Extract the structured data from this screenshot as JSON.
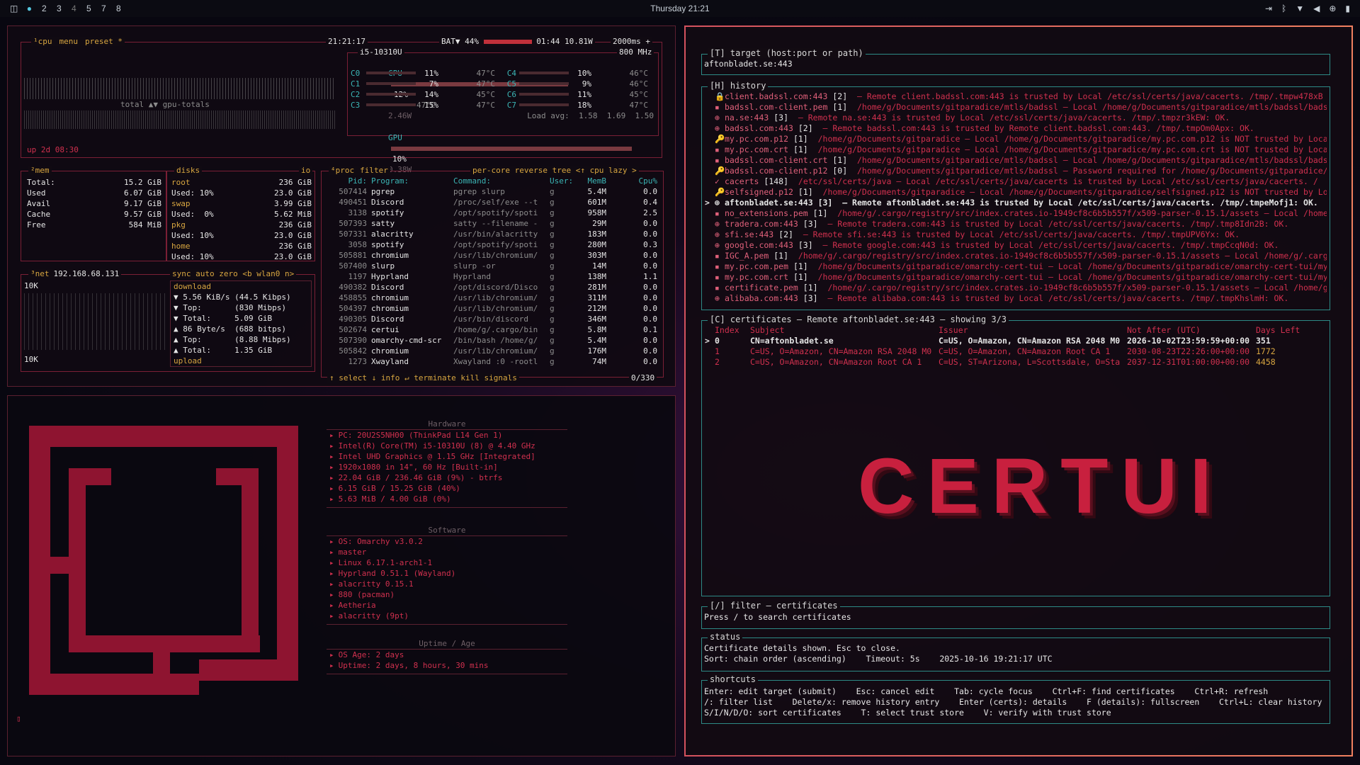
{
  "topbar": {
    "workspaces": [
      "2",
      "3",
      "4",
      "5",
      "7",
      "8"
    ],
    "clock": "Thursday 21:21"
  },
  "btop": {
    "cpu_header": {
      "tabs": [
        "¹cpu",
        "menu",
        "preset *"
      ],
      "time": "21:21:17",
      "battery": "BAT▼ 44%",
      "bat_time": "01:44 10.81W",
      "interval": "2000ms +"
    },
    "cpu_model": "i5-10310U",
    "freq": "800 MHz",
    "cpu_total": {
      "label": "CPU",
      "pct": "12%",
      "temp": "47°C",
      "watt": "2.46W"
    },
    "cores": [
      {
        "l": "C0",
        "p": "11%",
        "t": "47°C",
        "r": "C4",
        "rp": "10%",
        "rt": "46°C"
      },
      {
        "l": "C1",
        "p": "7%",
        "t": "47°C",
        "r": "C5",
        "rp": "9%",
        "rt": "46°C"
      },
      {
        "l": "C2",
        "p": "14%",
        "t": "45°C",
        "r": "C6",
        "rp": "11%",
        "rt": "45°C"
      },
      {
        "l": "C3",
        "p": "15%",
        "t": "47°C",
        "r": "C7",
        "rp": "18%",
        "rt": "47°C"
      }
    ],
    "load": "Load avg:  1.58  1.69  1.50",
    "gpu": {
      "label": "GPU",
      "pct": "10%",
      "watt": "0.38W"
    },
    "gpu_totals": "total ▲▼ gpu-totals",
    "uptime": "up 2d 08:30",
    "mem": {
      "title": "²mem",
      "rows": [
        [
          "Total:",
          "15.2 GiB"
        ],
        [
          "Used",
          "6.07 GiB"
        ],
        [
          "Avail",
          "9.17 GiB"
        ],
        [
          "Cache",
          "9.57 GiB"
        ],
        [
          "Free",
          "584 MiB"
        ]
      ]
    },
    "disks": {
      "title": "disks",
      "io": "io",
      "rows": [
        [
          "root",
          "236 GiB"
        ],
        [
          "Used: 10%",
          "23.0 GiB"
        ],
        [
          "swap",
          "3.99 GiB"
        ],
        [
          "Used:  0%",
          "5.62 MiB"
        ],
        [
          "pkg",
          "236 GiB"
        ],
        [
          "Used: 10%",
          "23.0 GiB"
        ],
        [
          "home",
          "236 GiB"
        ],
        [
          "Used: 10%",
          "23.0 GiB"
        ]
      ]
    },
    "net": {
      "title": "³net",
      "ip": "192.168.68.131",
      "tabs": "sync auto zero <b wlan0 n>",
      "scale_top": "10K",
      "scale_bot": "10K",
      "rows": [
        "download",
        "▼ 5.56 KiB/s (44.5 Kibps)",
        "▼ Top:       (830 Mibps)",
        "▼ Total:     5.09 GiB",
        "▲ 86 Byte/s  (688 bitps)",
        "▲ Top:       (8.88 Mibps)",
        "▲ Total:     1.35 GiB",
        "upload"
      ]
    },
    "proc": {
      "title": "⁴proc",
      "tabs": "filter",
      "opts": "per-core reverse tree <↑ cpu lazy >",
      "header": [
        "Pid:",
        "Program:",
        "Command:",
        "User:",
        "MemB",
        "Cpu%"
      ],
      "rows": [
        [
          "507414",
          "pgrep",
          "pgrep slurp",
          "g",
          "5.4M",
          "0.0"
        ],
        [
          "490451",
          "Discord",
          "/proc/self/exe --t",
          "g",
          "601M",
          "0.4"
        ],
        [
          "3138",
          "spotify",
          "/opt/spotify/spoti",
          "g",
          "958M",
          "2.5"
        ],
        [
          "507393",
          "satty",
          "satty --filename -",
          "g",
          "29M",
          "0.0"
        ],
        [
          "507331",
          "alacritty",
          "/usr/bin/alacritty",
          "g",
          "183M",
          "0.0"
        ],
        [
          "3058",
          "spotify",
          "/opt/spotify/spoti",
          "g",
          "280M",
          "0.3"
        ],
        [
          "505881",
          "chromium",
          "/usr/lib/chromium/",
          "g",
          "303M",
          "0.0"
        ],
        [
          "507400",
          "slurp",
          "slurp -or",
          "g",
          "14M",
          "0.0"
        ],
        [
          "1197",
          "Hyprland",
          "Hyprland",
          "g",
          "138M",
          "1.1"
        ],
        [
          "490382",
          "Discord",
          "/opt/discord/Disco",
          "g",
          "281M",
          "0.0"
        ],
        [
          "458855",
          "chromium",
          "/usr/lib/chromium/",
          "g",
          "311M",
          "0.0"
        ],
        [
          "504397",
          "chromium",
          "/usr/lib/chromium/",
          "g",
          "212M",
          "0.0"
        ],
        [
          "490305",
          "Discord",
          "/usr/bin/discord",
          "g",
          "346M",
          "0.0"
        ],
        [
          "502674",
          "certui",
          "/home/g/.cargo/bin",
          "g",
          "5.8M",
          "0.1"
        ],
        [
          "507390",
          "omarchy-cmd-scr",
          "/bin/bash /home/g/",
          "g",
          "5.4M",
          "0.0"
        ],
        [
          "505842",
          "chromium",
          "/usr/lib/chromium/",
          "g",
          "176M",
          "0.0"
        ],
        [
          "1273",
          "Xwayland",
          "Xwayland :0 -rootl",
          "g",
          "74M",
          "0.0"
        ]
      ],
      "footer": "↑ select ↓  info ↵  terminate  kill  signals",
      "count": "0/330"
    }
  },
  "fastfetch": {
    "hardware_title": "Hardware",
    "hardware": [
      "PC: 20U2S5NH00 (ThinkPad L14 Gen 1)",
      "Intel(R) Core(TM) i5-10310U (8) @ 4.40 GHz",
      "Intel UHD Graphics @ 1.15 GHz [Integrated]",
      "1920x1080 in 14\", 60 Hz [Built-in]",
      "22.04 GiB / 236.46 GiB (9%) - btrfs",
      "6.15 GiB / 15.25 GiB (40%)",
      "5.63 MiB / 4.00 GiB (0%)"
    ],
    "software_title": "Software",
    "software": [
      "OS: Omarchy v3.0.2",
      "master",
      "Linux 6.17.1-arch1-1",
      "Hyprland 0.51.1 (Wayland)",
      "alacritty 0.15.1",
      "880 (pacman)",
      "Aetheria",
      "alacritty (9pt)"
    ],
    "uptime_title": "Uptime / Age",
    "uptime": [
      "OS Age: 2 days",
      "Uptime: 2 days, 8 hours, 30 mins"
    ],
    "prompt": "▯"
  },
  "certui": {
    "target_title": "[T] target (host:port or path)",
    "target_value": "aftonbladet.se:443",
    "history_title": "[H] history",
    "history": [
      {
        "icon": "🔒",
        "name": "client.badssl.com:443",
        "count": "[2]",
        "rest": "– Remote client.badssl.com:443 is trusted by Local /etc/ssl/certs/java/cacerts. /tmp/.tmpw478xB"
      },
      {
        "icon": "▪",
        "name": "badssl.com-client.pem",
        "count": "[1]",
        "rest": "/home/g/Documents/gitparadice/mtls/badssl – Local /home/g/Documents/gitparadice/mtls/badssl/bads"
      },
      {
        "icon": "⊕",
        "name": "na.se:443",
        "count": "[3]",
        "rest": "– Remote na.se:443 is trusted by Local /etc/ssl/certs/java/cacerts. /tmp/.tmpzr3kEW: OK."
      },
      {
        "icon": "⊕",
        "name": "badssl.com:443",
        "count": "[2]",
        "rest": "– Remote badssl.com:443 is trusted by Remote client.badssl.com:443. /tmp/.tmpOm0Apx: OK."
      },
      {
        "icon": "🔑",
        "name": "my.pc.com.p12",
        "count": "[1]",
        "rest": "/home/g/Documents/gitparadice – Local /home/g/Documents/gitparadice/my.pc.com.p12 is NOT trusted by Loca"
      },
      {
        "icon": "▪",
        "name": "my.pc.com.crt",
        "count": "[1]",
        "rest": "/home/g/Documents/gitparadice – Local /home/g/Documents/gitparadice/my.pc.com.crt is NOT trusted by Loca"
      },
      {
        "icon": "▪",
        "name": "badssl.com-client.crt",
        "count": "[1]",
        "rest": "/home/g/Documents/gitparadice/mtls/badssl – Local /home/g/Documents/gitparadice/mtls/badssl/bads"
      },
      {
        "icon": "🔑",
        "name": "badssl.com-client.p12",
        "count": "[0]",
        "rest": "/home/g/Documents/gitparadice/mtls/badssl – Password required for /home/g/Documents/gitparadice/"
      },
      {
        "icon": "✓",
        "name": "cacerts",
        "count": "[148]",
        "rest": "/etc/ssl/certs/java – Local /etc/ssl/certs/java/cacerts is trusted by Local /etc/ssl/certs/java/cacerts. /"
      },
      {
        "icon": "🔑",
        "name": "selfsigned.p12",
        "count": "[1]",
        "rest": "/home/g/Documents/gitparadice – Local /home/g/Documents/gitparadice/selfsigned.p12 is NOT trusted by Lo"
      },
      {
        "icon": "⊕",
        "name": "aftonbladet.se:443",
        "count": "[3]",
        "rest": "– Remote aftonbladet.se:443 is trusted by Local /etc/ssl/certs/java/cacerts. /tmp/.tmpeMofj1: OK.",
        "selected": true
      },
      {
        "icon": "▪",
        "name": "no_extensions.pem",
        "count": "[1]",
        "rest": "/home/g/.cargo/registry/src/index.crates.io-1949cf8c6b5b557f/x509-parser-0.15.1/assets – Local /home"
      },
      {
        "icon": "⊕",
        "name": "tradera.com:443",
        "count": "[3]",
        "rest": "– Remote tradera.com:443 is trusted by Local /etc/ssl/certs/java/cacerts. /tmp/.tmp8Idn2B: OK."
      },
      {
        "icon": "⊕",
        "name": "sfi.se:443",
        "count": "[2]",
        "rest": "– Remote sfi.se:443 is trusted by Local /etc/ssl/certs/java/cacerts. /tmp/.tmpUPV6Yx: OK."
      },
      {
        "icon": "⊕",
        "name": "google.com:443",
        "count": "[3]",
        "rest": "– Remote google.com:443 is trusted by Local /etc/ssl/certs/java/cacerts. /tmp/.tmpCcqN0d: OK."
      },
      {
        "icon": "▪",
        "name": "IGC_A.pem",
        "count": "[1]",
        "rest": "/home/g/.cargo/registry/src/index.crates.io-1949cf8c6b5b557f/x509-parser-0.15.1/assets – Local /home/g/.carg"
      },
      {
        "icon": "▪",
        "name": "my.pc.com.pem",
        "count": "[1]",
        "rest": "/home/g/Documents/gitparadice/omarchy-cert-tui – Local /home/g/Documents/gitparadice/omarchy-cert-tui/my"
      },
      {
        "icon": "▪",
        "name": "my.pc.com.crt",
        "count": "[1]",
        "rest": "/home/g/Documents/gitparadice/omarchy-cert-tui – Local /home/g/Documents/gitparadice/omarchy-cert-tui/my"
      },
      {
        "icon": "▪",
        "name": "certificate.pem",
        "count": "[1]",
        "rest": "/home/g/.cargo/registry/src/index.crates.io-1949cf8c6b5b557f/x509-parser-0.15.1/assets – Local /home/g"
      },
      {
        "icon": "⊕",
        "name": "alibaba.com:443",
        "count": "[3]",
        "rest": "– Remote alibaba.com:443 is trusted by Local /etc/ssl/certs/java/cacerts. /tmp/.tmpKhslmH: OK."
      }
    ],
    "certs_title": "[C] certificates – Remote aftonbladet.se:443 – showing 3/3",
    "cert_headers": [
      "Index",
      "Subject",
      "Issuer",
      "Not After (UTC)",
      "Days Left"
    ],
    "certs": [
      {
        "idx": "0",
        "subject": "CN=aftonbladet.se",
        "issuer": "C=US, O=Amazon, CN=Amazon RSA 2048 M0",
        "notafter": "2026-10-02T23:59:59+00:00",
        "days": "351",
        "selected": true
      },
      {
        "idx": "1",
        "subject": "C=US, O=Amazon, CN=Amazon RSA 2048 M0",
        "issuer": "C=US, O=Amazon, CN=Amazon Root CA 1",
        "notafter": "2030-08-23T22:26:00+00:00",
        "days": "1772"
      },
      {
        "idx": "2",
        "subject": "C=US, O=Amazon, CN=Amazon Root CA 1",
        "issuer": "C=US, ST=Arizona, L=Scottsdale, O=Sta",
        "notafter": "2037-12-31T01:00:00+00:00",
        "days": "4458"
      }
    ],
    "logo": "CERTUI",
    "filter_title": "[/] filter – certificates",
    "filter_text": "Press / to search certificates",
    "status_title": "status",
    "status_lines": [
      "Certificate details shown. Esc to close.",
      "Sort: chain order (ascending)    Timeout: 5s    2025-10-16 19:21:17 UTC"
    ],
    "shortcuts_title": "shortcuts",
    "shortcuts": [
      "Enter: edit target (submit)    Esc: cancel edit    Tab: cycle focus    Ctrl+F: find certificates    Ctrl+R: refresh",
      "/: filter list    Delete/x: remove history entry    Enter (certs): details    F (details): fullscreen    Ctrl+L: clear history",
      "S/I/N/D/O: sort certificates    T: select trust store    V: verify with trust store"
    ]
  }
}
